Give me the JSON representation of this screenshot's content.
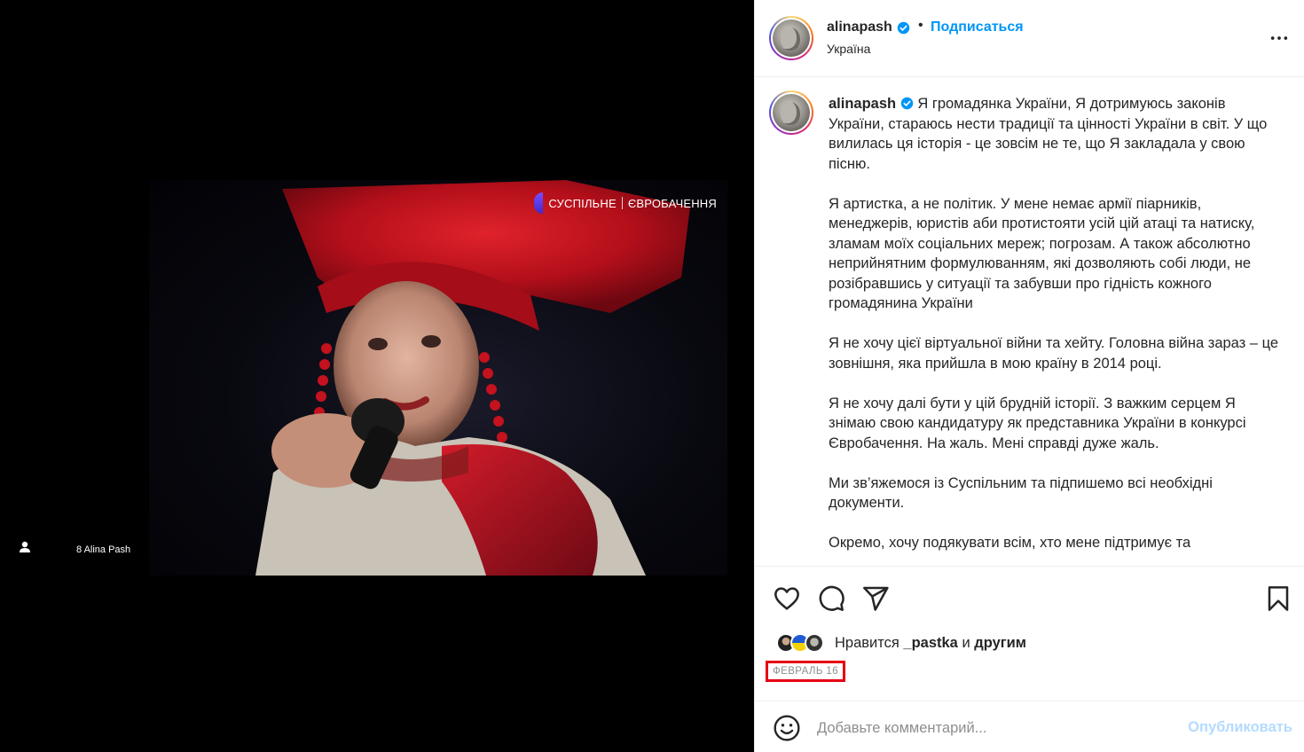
{
  "media": {
    "watermark": {
      "left": "СУСПІЛЬНЕ",
      "right": "ЄВРОБАЧЕННЯ"
    },
    "tag_caption": "8 Alina Pash"
  },
  "header": {
    "username": "alinapash",
    "separator": "•",
    "follow_label": "Подписаться",
    "location": "Україна"
  },
  "caption": {
    "username": "alinapash",
    "paragraphs": [
      "Я громадянка України, Я дотримуюсь законів України, стараюсь нести традиції та цінності України в світ. У що вилилась ця історія - це зовсім не те, що Я закладала у свою пісню.",
      "Я артистка, а не політик. У мене немає армії піарників, менеджерів, юристів аби протистояти усій цій атаці та натиску, зламам моїх соціальних мереж; погрозам. А також абсолютно неприйнятним формулюванням, які дозволяють собі люди, не розібравшись у ситуації та забувши про гідність кожного громадянина України",
      "Я не хочу цієї віртуальної війни та хейту. Головна війна зараз – це зовнішня, яка прийшла в мою країну в 2014 році.",
      "Я не хочу далі бути у цій брудній історії. З важким серцем Я знімаю свою кандидатуру як представника України в конкурсі Євробачення. На жаль. Мені справді дуже жаль.",
      "Ми зв’яжемося із Суспільним та підпишемо всі необхідні документи.",
      "Окремо, хочу подякувати всім, хто мене підтримує та"
    ]
  },
  "likes": {
    "prefix": "Нравится",
    "user": "_pastka",
    "conjunction": "и",
    "others": "другим"
  },
  "date": "ФЕВРАЛЬ 16",
  "comment": {
    "placeholder": "Добавьте комментарий...",
    "publish_label": "Опубликовать"
  },
  "colors": {
    "accent": "#0095f6",
    "publish_disabled": "#b3dbff",
    "highlight_box": "#e60012"
  }
}
